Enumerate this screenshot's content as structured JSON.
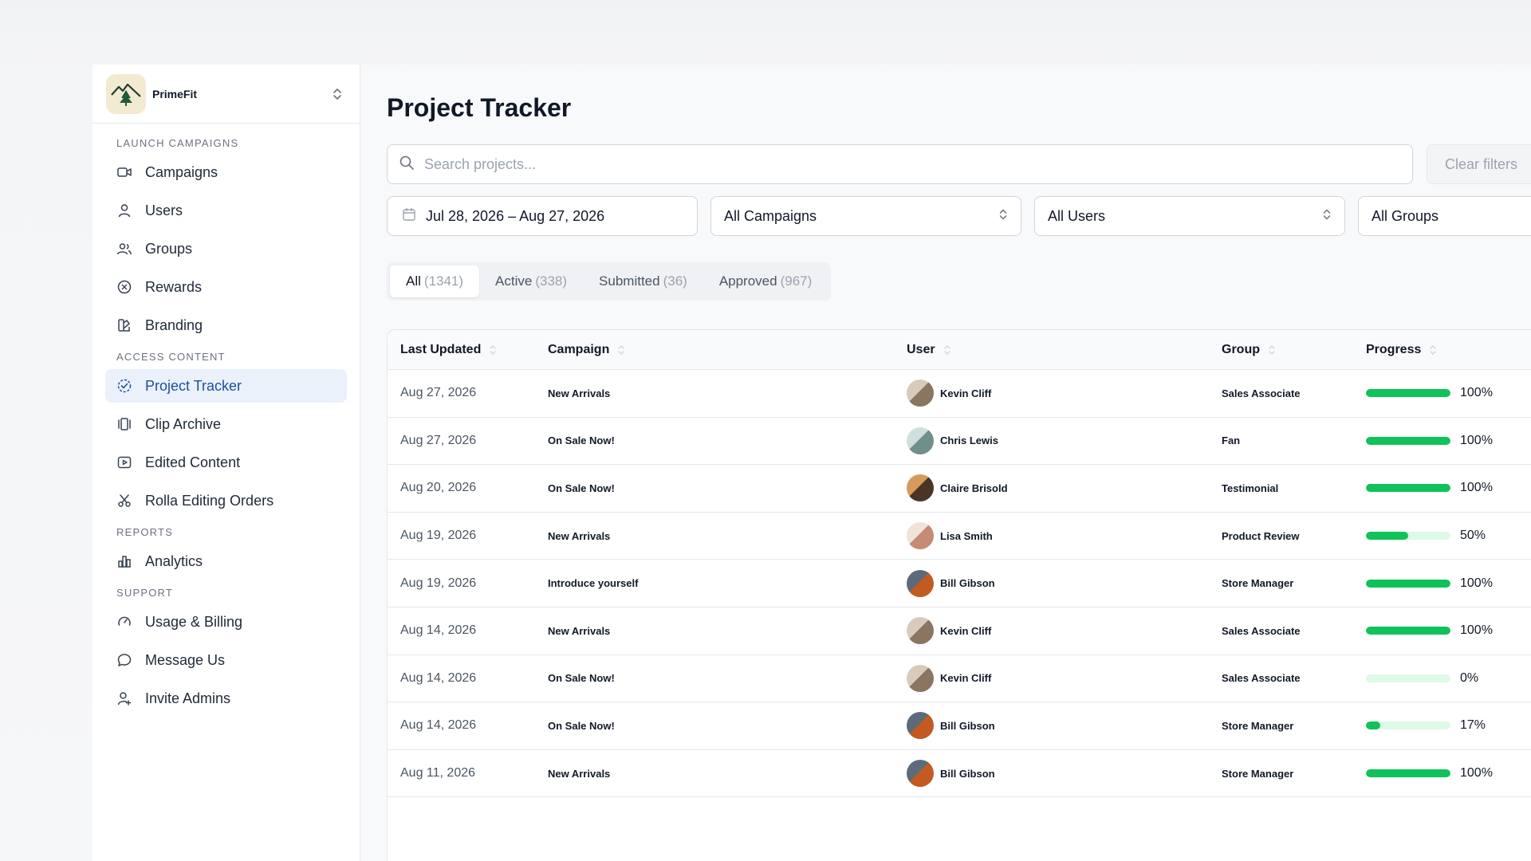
{
  "brand": {
    "name": "PrimeFit"
  },
  "sidebar": {
    "sections": [
      {
        "title": "LAUNCH CAMPAIGNS",
        "items": [
          {
            "label": "Campaigns",
            "icon": "video-camera-icon"
          },
          {
            "label": "Users",
            "icon": "user-icon"
          },
          {
            "label": "Groups",
            "icon": "users-icon"
          },
          {
            "label": "Rewards",
            "icon": "reward-badge-icon"
          },
          {
            "label": "Branding",
            "icon": "brand-swatch-icon"
          }
        ]
      },
      {
        "title": "ACCESS CONTENT",
        "items": [
          {
            "label": "Project Tracker",
            "icon": "progress-check-icon",
            "active": true
          },
          {
            "label": "Clip Archive",
            "icon": "film-clip-icon"
          },
          {
            "label": "Edited Content",
            "icon": "play-square-icon"
          },
          {
            "label": "Rolla Editing Orders",
            "icon": "scissors-icon"
          }
        ]
      },
      {
        "title": "REPORTS",
        "items": [
          {
            "label": "Analytics",
            "icon": "bar-chart-icon"
          }
        ]
      },
      {
        "title": "SUPPORT",
        "items": [
          {
            "label": "Usage & Billing",
            "icon": "gauge-icon"
          },
          {
            "label": "Message Us",
            "icon": "chat-bubble-icon"
          },
          {
            "label": "Invite Admins",
            "icon": "user-plus-icon"
          }
        ]
      }
    ]
  },
  "page": {
    "title": "Project Tracker"
  },
  "search": {
    "placeholder": "Search projects...",
    "value": ""
  },
  "clear_filters": "Clear filters",
  "filters": {
    "date_range": "Jul 28, 2026 – Aug 27, 2026",
    "campaigns": "All Campaigns",
    "users": "All Users",
    "groups": "All Groups"
  },
  "tabs": [
    {
      "label": "All",
      "count": "(1341)",
      "active": true
    },
    {
      "label": "Active",
      "count": "(338)"
    },
    {
      "label": "Submitted",
      "count": "(36)"
    },
    {
      "label": "Approved",
      "count": "(967)"
    }
  ],
  "table": {
    "columns": [
      "Last Updated",
      "Campaign",
      "User",
      "Group",
      "Progress"
    ],
    "rows": [
      {
        "date": "Aug 27, 2026",
        "campaign": "New Arrivals",
        "user": "Kevin Cliff",
        "group": "Sales Associate",
        "progress": 100,
        "progress_label": "100%"
      },
      {
        "date": "Aug 27, 2026",
        "campaign": "On Sale Now!",
        "user": "Chris Lewis",
        "group": "Fan",
        "progress": 100,
        "progress_label": "100%"
      },
      {
        "date": "Aug 20, 2026",
        "campaign": "On Sale Now!",
        "user": "Claire Brisold",
        "group": "Testimonial",
        "progress": 100,
        "progress_label": "100%"
      },
      {
        "date": "Aug 19, 2026",
        "campaign": "New Arrivals",
        "user": "Lisa Smith",
        "group": "Product Review",
        "progress": 50,
        "progress_label": "50%"
      },
      {
        "date": "Aug 19, 2026",
        "campaign": "Introduce yourself",
        "user": "Bill Gibson",
        "group": "Store Manager",
        "progress": 100,
        "progress_label": "100%"
      },
      {
        "date": "Aug 14, 2026",
        "campaign": "New Arrivals",
        "user": "Kevin Cliff",
        "group": "Sales Associate",
        "progress": 100,
        "progress_label": "100%"
      },
      {
        "date": "Aug 14, 2026",
        "campaign": "On Sale Now!",
        "user": "Kevin Cliff",
        "group": "Sales Associate",
        "progress": 0,
        "progress_label": "0%"
      },
      {
        "date": "Aug 14, 2026",
        "campaign": "On Sale Now!",
        "user": "Bill Gibson",
        "group": "Store Manager",
        "progress": 17,
        "progress_label": "17%"
      },
      {
        "date": "Aug 11, 2026",
        "campaign": "New Arrivals",
        "user": "Bill Gibson",
        "group": "Store Manager",
        "progress": 100,
        "progress_label": "100%"
      }
    ]
  },
  "colors": {
    "accent": "#1e4e9a",
    "active_bg": "#eaf1fb",
    "progress_fill": "#10c25a",
    "progress_track": "#dcfae6"
  }
}
